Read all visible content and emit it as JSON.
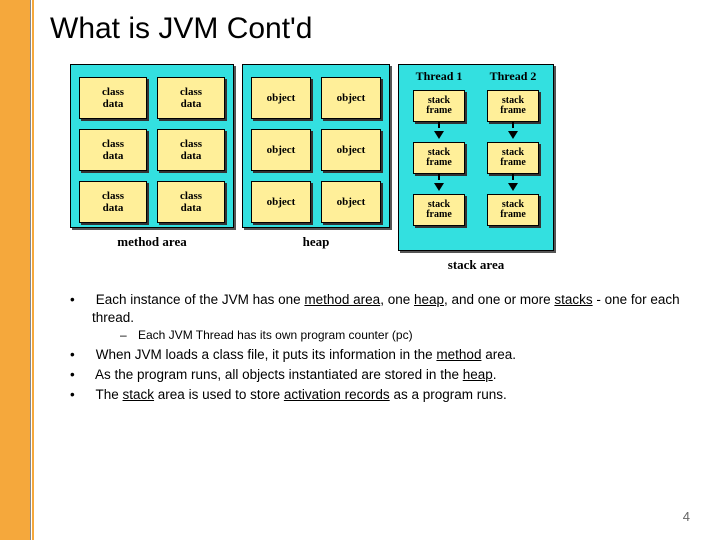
{
  "title": "What is JVM Cont'd",
  "diagram": {
    "method_area": {
      "cell_label": "class\ndata",
      "label": "method area"
    },
    "heap": {
      "cell_label": "object",
      "label": "heap"
    },
    "stack": {
      "thread1": "Thread 1",
      "thread2": "Thread 2",
      "cell_label": "stack\nframe",
      "label": "stack area"
    }
  },
  "bullets": {
    "b1a": "Each instance of the JVM has one ",
    "b1_method": "method area",
    "b1b": ", one ",
    "b1_heap": "heap",
    "b1c": ", and one or more ",
    "b1_stacks": "stacks",
    "b1d": " - one for each thread.",
    "sub1": "Each JVM Thread has its own program counter (pc)",
    "b2a": "When JVM loads a class file, it puts its information in the ",
    "b2_method": "method",
    "b2b": " area.",
    "b3a": "As the program runs, all objects instantiated are stored in the ",
    "b3_heap": "heap",
    "b3b": ".",
    "b4a": "The ",
    "b4_stack": "stack",
    "b4b": " area is used to store ",
    "b4_act": "activation records",
    "b4c": " as a program runs."
  },
  "page": "4"
}
